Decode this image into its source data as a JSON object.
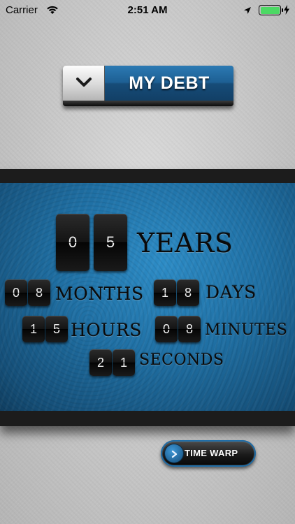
{
  "status_bar": {
    "carrier": "Carrier",
    "time": "2:51 AM",
    "icons": [
      "wifi-icon",
      "location-arrow-icon",
      "battery-icon",
      "charging-bolt-icon"
    ],
    "battery_color": "#4cd964"
  },
  "debt_selector": {
    "label": "MY DEBT",
    "icon": "chevron-down-icon",
    "accent_color": "#1d5f93"
  },
  "countdown": {
    "years": {
      "digits": [
        "0",
        "5"
      ],
      "label": "YEARS"
    },
    "months": {
      "digits": [
        "0",
        "8"
      ],
      "label": "MONTHS"
    },
    "days": {
      "digits": [
        "1",
        "8"
      ],
      "label": "DAYS"
    },
    "hours": {
      "digits": [
        "1",
        "5"
      ],
      "label": "HOURS"
    },
    "minutes": {
      "digits": [
        "0",
        "8"
      ],
      "label": "MINUTES"
    },
    "seconds": {
      "digits": [
        "2",
        "1"
      ],
      "label": "SECONDS"
    }
  },
  "panel": {
    "color": "#1f6fa3"
  },
  "time_warp": {
    "label": "TIME WARP",
    "icon": "chevron-right-icon"
  }
}
